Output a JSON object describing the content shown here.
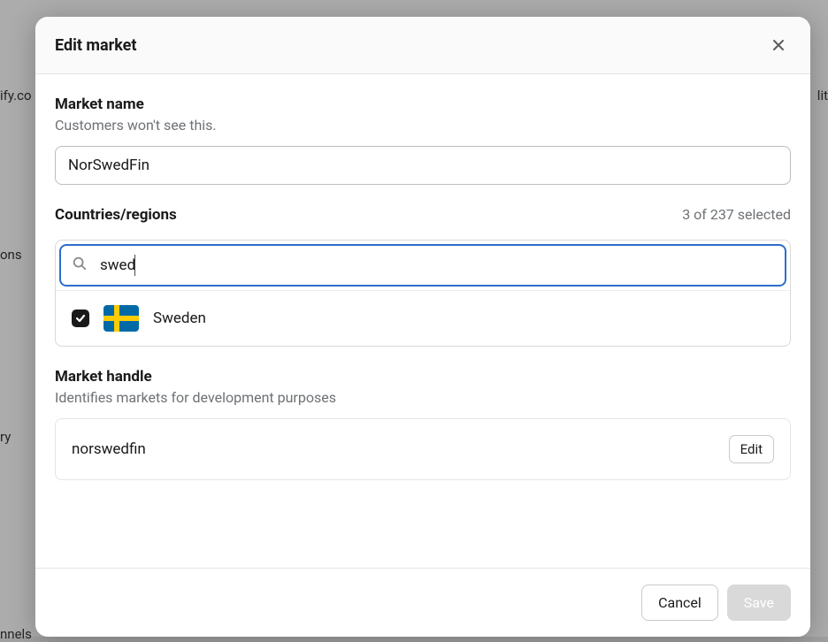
{
  "backdrop": {
    "text1": "ify.co",
    "text2": "ons",
    "text3": "ry",
    "text4": "nnels",
    "text5": "lit"
  },
  "modal": {
    "title": "Edit market",
    "market_name": {
      "label": "Market name",
      "help": "Customers won't see this.",
      "value": "NorSwedFin"
    },
    "countries": {
      "label": "Countries/regions",
      "selected_text": "3 of 237 selected",
      "search_value": "swed",
      "options": [
        {
          "label": "Sweden",
          "checked": true,
          "flag": "se"
        }
      ]
    },
    "handle": {
      "label": "Market handle",
      "help": "Identifies markets for development purposes",
      "value": "norswedfin",
      "edit_label": "Edit"
    },
    "footer": {
      "cancel": "Cancel",
      "save": "Save"
    }
  }
}
